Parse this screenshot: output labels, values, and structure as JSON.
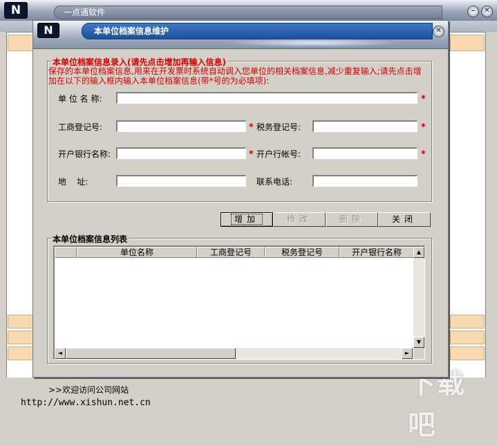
{
  "outer": {
    "title": "一点通软件",
    "logo": "N",
    "minimize_glyph": "–",
    "close_glyph": "✕",
    "welcome": ">>欢迎访问公司网站",
    "url": "http://www.xishun.net.cn",
    "watermark": "下载吧"
  },
  "dialog": {
    "title": "本单位档案信息维护",
    "logo": "N",
    "close_glyph": "✕",
    "entry_group_title": "本单位档案信息录入(请先点击增加再输入信息)",
    "intro": "保存的本单位档案信息,用来在开发票时系统自动调入您单位的相关档案信息,减少重复输入;请先点击增加在以下的输入框内输入本单位档案信息(带*号的为必填项):",
    "required_mark": "*",
    "fields": {
      "unit_name": {
        "label": "单 位 名 称:",
        "value": ""
      },
      "biz_reg_no": {
        "label": "工商登记号:",
        "value": ""
      },
      "tax_reg_no": {
        "label": "税务登记号:",
        "value": ""
      },
      "bank_name": {
        "label": "开户银行名称:",
        "value": ""
      },
      "bank_account": {
        "label": "开户行帐号:",
        "value": ""
      },
      "address": {
        "label": "地    址:",
        "value": ""
      },
      "phone": {
        "label": "联系电话:",
        "value": ""
      }
    },
    "buttons": {
      "add": "增加",
      "edit": "修改",
      "delete": "删除",
      "close": "关闭"
    },
    "list_group_title": "本单位档案信息列表",
    "list_columns": [
      "",
      "单位名称",
      "工商登记号",
      "税务登记号",
      "开户银行名称"
    ]
  },
  "icons": {
    "scroll_up": "▲",
    "scroll_down": "▼",
    "scroll_left": "◄",
    "scroll_right": "►"
  }
}
